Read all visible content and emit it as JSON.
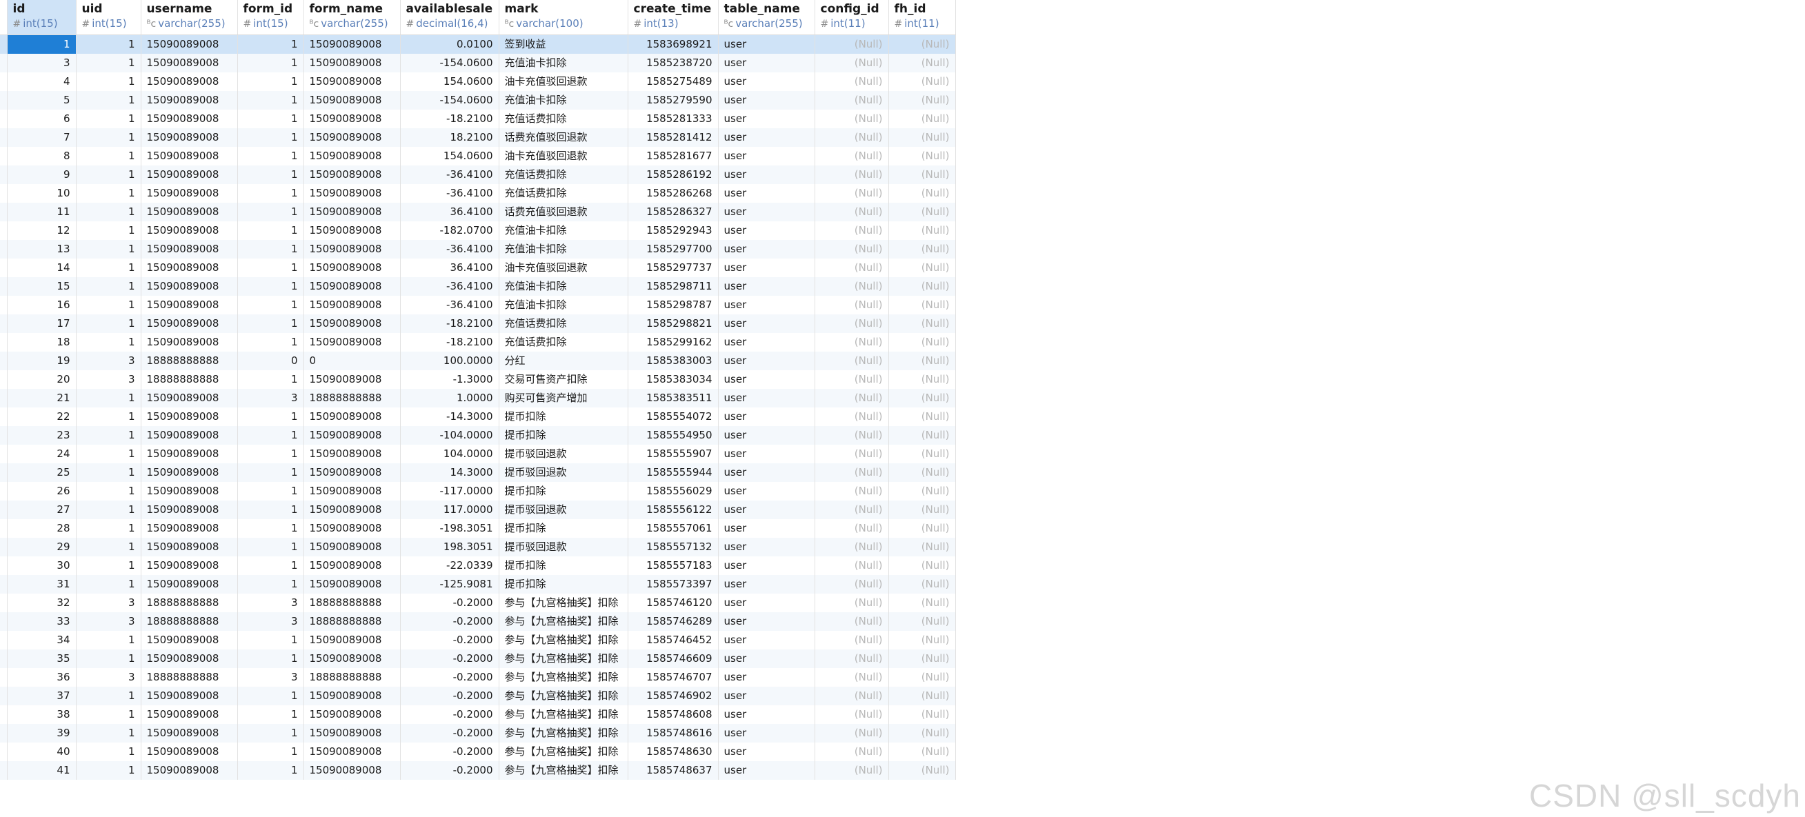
{
  "columns": [
    {
      "key": "id",
      "name": "id",
      "type": "int(15)",
      "icon": "#"
    },
    {
      "key": "uid",
      "name": "uid",
      "type": "int(15)",
      "icon": "#"
    },
    {
      "key": "username",
      "name": "username",
      "type": "varchar(255)",
      "icon": "ᴮc"
    },
    {
      "key": "form_id",
      "name": "form_id",
      "type": "int(15)",
      "icon": "#"
    },
    {
      "key": "form_name",
      "name": "form_name",
      "type": "varchar(255)",
      "icon": "ᴮc"
    },
    {
      "key": "availablesale",
      "name": "availablesale",
      "type": "decimal(16,4)",
      "icon": "#"
    },
    {
      "key": "mark",
      "name": "mark",
      "type": "varchar(100)",
      "icon": "ᴮc"
    },
    {
      "key": "create_time",
      "name": "create_time",
      "type": "int(13)",
      "icon": "#"
    },
    {
      "key": "table_name",
      "name": "table_name",
      "type": "varchar(255)",
      "icon": "ᴮc"
    },
    {
      "key": "config_id",
      "name": "config_id",
      "type": "int(11)",
      "icon": "#"
    },
    {
      "key": "fh_id",
      "name": "fh_id",
      "type": "int(11)",
      "icon": "#"
    }
  ],
  "null_text": "(Null)",
  "rows": [
    [
      "1",
      "1",
      "15090089008",
      "1",
      "15090089008",
      "0.0100",
      "签到收益",
      "1583698921",
      "user"
    ],
    [
      "3",
      "1",
      "15090089008",
      "1",
      "15090089008",
      "-154.0600",
      "充值油卡扣除",
      "1585238720",
      "user"
    ],
    [
      "4",
      "1",
      "15090089008",
      "1",
      "15090089008",
      "154.0600",
      "油卡充值驳回退款",
      "1585275489",
      "user"
    ],
    [
      "5",
      "1",
      "15090089008",
      "1",
      "15090089008",
      "-154.0600",
      "充值油卡扣除",
      "1585279590",
      "user"
    ],
    [
      "6",
      "1",
      "15090089008",
      "1",
      "15090089008",
      "-18.2100",
      "充值话费扣除",
      "1585281333",
      "user"
    ],
    [
      "7",
      "1",
      "15090089008",
      "1",
      "15090089008",
      "18.2100",
      "话费充值驳回退款",
      "1585281412",
      "user"
    ],
    [
      "8",
      "1",
      "15090089008",
      "1",
      "15090089008",
      "154.0600",
      "油卡充值驳回退款",
      "1585281677",
      "user"
    ],
    [
      "9",
      "1",
      "15090089008",
      "1",
      "15090089008",
      "-36.4100",
      "充值话费扣除",
      "1585286192",
      "user"
    ],
    [
      "10",
      "1",
      "15090089008",
      "1",
      "15090089008",
      "-36.4100",
      "充值话费扣除",
      "1585286268",
      "user"
    ],
    [
      "11",
      "1",
      "15090089008",
      "1",
      "15090089008",
      "36.4100",
      "话费充值驳回退款",
      "1585286327",
      "user"
    ],
    [
      "12",
      "1",
      "15090089008",
      "1",
      "15090089008",
      "-182.0700",
      "充值油卡扣除",
      "1585292943",
      "user"
    ],
    [
      "13",
      "1",
      "15090089008",
      "1",
      "15090089008",
      "-36.4100",
      "充值油卡扣除",
      "1585297700",
      "user"
    ],
    [
      "14",
      "1",
      "15090089008",
      "1",
      "15090089008",
      "36.4100",
      "油卡充值驳回退款",
      "1585297737",
      "user"
    ],
    [
      "15",
      "1",
      "15090089008",
      "1",
      "15090089008",
      "-36.4100",
      "充值油卡扣除",
      "1585298711",
      "user"
    ],
    [
      "16",
      "1",
      "15090089008",
      "1",
      "15090089008",
      "-36.4100",
      "充值油卡扣除",
      "1585298787",
      "user"
    ],
    [
      "17",
      "1",
      "15090089008",
      "1",
      "15090089008",
      "-18.2100",
      "充值话费扣除",
      "1585298821",
      "user"
    ],
    [
      "18",
      "1",
      "15090089008",
      "1",
      "15090089008",
      "-18.2100",
      "充值话费扣除",
      "1585299162",
      "user"
    ],
    [
      "19",
      "3",
      "18888888888",
      "0",
      "0",
      "100.0000",
      "分红",
      "1585383003",
      "user"
    ],
    [
      "20",
      "3",
      "18888888888",
      "1",
      "15090089008",
      "-1.3000",
      "交易可售资产扣除",
      "1585383034",
      "user"
    ],
    [
      "21",
      "1",
      "15090089008",
      "3",
      "18888888888",
      "1.0000",
      "购买可售资产增加",
      "1585383511",
      "user"
    ],
    [
      "22",
      "1",
      "15090089008",
      "1",
      "15090089008",
      "-14.3000",
      "提币扣除",
      "1585554072",
      "user"
    ],
    [
      "23",
      "1",
      "15090089008",
      "1",
      "15090089008",
      "-104.0000",
      "提币扣除",
      "1585554950",
      "user"
    ],
    [
      "24",
      "1",
      "15090089008",
      "1",
      "15090089008",
      "104.0000",
      "提币驳回退款",
      "1585555907",
      "user"
    ],
    [
      "25",
      "1",
      "15090089008",
      "1",
      "15090089008",
      "14.3000",
      "提币驳回退款",
      "1585555944",
      "user"
    ],
    [
      "26",
      "1",
      "15090089008",
      "1",
      "15090089008",
      "-117.0000",
      "提币扣除",
      "1585556029",
      "user"
    ],
    [
      "27",
      "1",
      "15090089008",
      "1",
      "15090089008",
      "117.0000",
      "提币驳回退款",
      "1585556122",
      "user"
    ],
    [
      "28",
      "1",
      "15090089008",
      "1",
      "15090089008",
      "-198.3051",
      "提币扣除",
      "1585557061",
      "user"
    ],
    [
      "29",
      "1",
      "15090089008",
      "1",
      "15090089008",
      "198.3051",
      "提币驳回退款",
      "1585557132",
      "user"
    ],
    [
      "30",
      "1",
      "15090089008",
      "1",
      "15090089008",
      "-22.0339",
      "提币扣除",
      "1585557183",
      "user"
    ],
    [
      "31",
      "1",
      "15090089008",
      "1",
      "15090089008",
      "-125.9081",
      "提币扣除",
      "1585573397",
      "user"
    ],
    [
      "32",
      "3",
      "18888888888",
      "3",
      "18888888888",
      "-0.2000",
      "参与【九宫格抽奖】扣除",
      "1585746120",
      "user"
    ],
    [
      "33",
      "3",
      "18888888888",
      "3",
      "18888888888",
      "-0.2000",
      "参与【九宫格抽奖】扣除",
      "1585746289",
      "user"
    ],
    [
      "34",
      "1",
      "15090089008",
      "1",
      "15090089008",
      "-0.2000",
      "参与【九宫格抽奖】扣除",
      "1585746452",
      "user"
    ],
    [
      "35",
      "1",
      "15090089008",
      "1",
      "15090089008",
      "-0.2000",
      "参与【九宫格抽奖】扣除",
      "1585746609",
      "user"
    ],
    [
      "36",
      "3",
      "18888888888",
      "3",
      "18888888888",
      "-0.2000",
      "参与【九宫格抽奖】扣除",
      "1585746707",
      "user"
    ],
    [
      "37",
      "1",
      "15090089008",
      "1",
      "15090089008",
      "-0.2000",
      "参与【九宫格抽奖】扣除",
      "1585746902",
      "user"
    ],
    [
      "38",
      "1",
      "15090089008",
      "1",
      "15090089008",
      "-0.2000",
      "参与【九宫格抽奖】扣除",
      "1585748608",
      "user"
    ],
    [
      "39",
      "1",
      "15090089008",
      "1",
      "15090089008",
      "-0.2000",
      "参与【九宫格抽奖】扣除",
      "1585748616",
      "user"
    ],
    [
      "40",
      "1",
      "15090089008",
      "1",
      "15090089008",
      "-0.2000",
      "参与【九宫格抽奖】扣除",
      "1585748630",
      "user"
    ],
    [
      "41",
      "1",
      "15090089008",
      "1",
      "15090089008",
      "-0.2000",
      "参与【九宫格抽奖】扣除",
      "1585748637",
      "user"
    ]
  ],
  "selected_row": 0,
  "watermark": "CSDN @sll_scdyh"
}
